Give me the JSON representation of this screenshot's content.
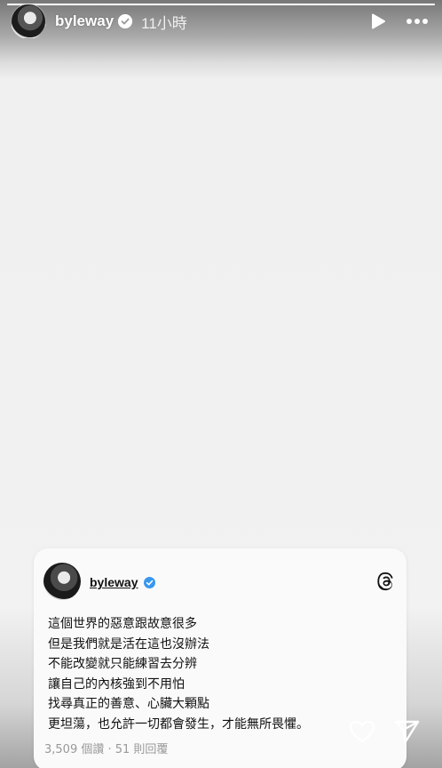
{
  "story": {
    "progress": 1.0
  },
  "header": {
    "username": "byleway",
    "verified": true,
    "time": "11小時",
    "icons": {
      "play": "play-icon",
      "more": "more-icon",
      "verified": "verified-badge-icon"
    }
  },
  "card": {
    "username": "byleway",
    "verified": true,
    "lines": [
      "這個世界的惡意跟故意很多",
      "但是我們就是活在這也沒辦法",
      "不能改變就只能練習去分辨",
      "讓自己的內核強到不用怕",
      "找尋真正的善意、心臟大顆點",
      "更坦蕩，也允許一切都會發生，才能無所畏懼。"
    ],
    "stats": "3,509 個讚 · 51 則回覆",
    "icons": {
      "threads": "threads-logo-icon"
    }
  },
  "actions": {
    "icons": {
      "like": "heart-icon",
      "share": "send-icon"
    }
  },
  "colors": {
    "verified": "#3897f0",
    "text": "#111111",
    "muted": "#999999"
  }
}
